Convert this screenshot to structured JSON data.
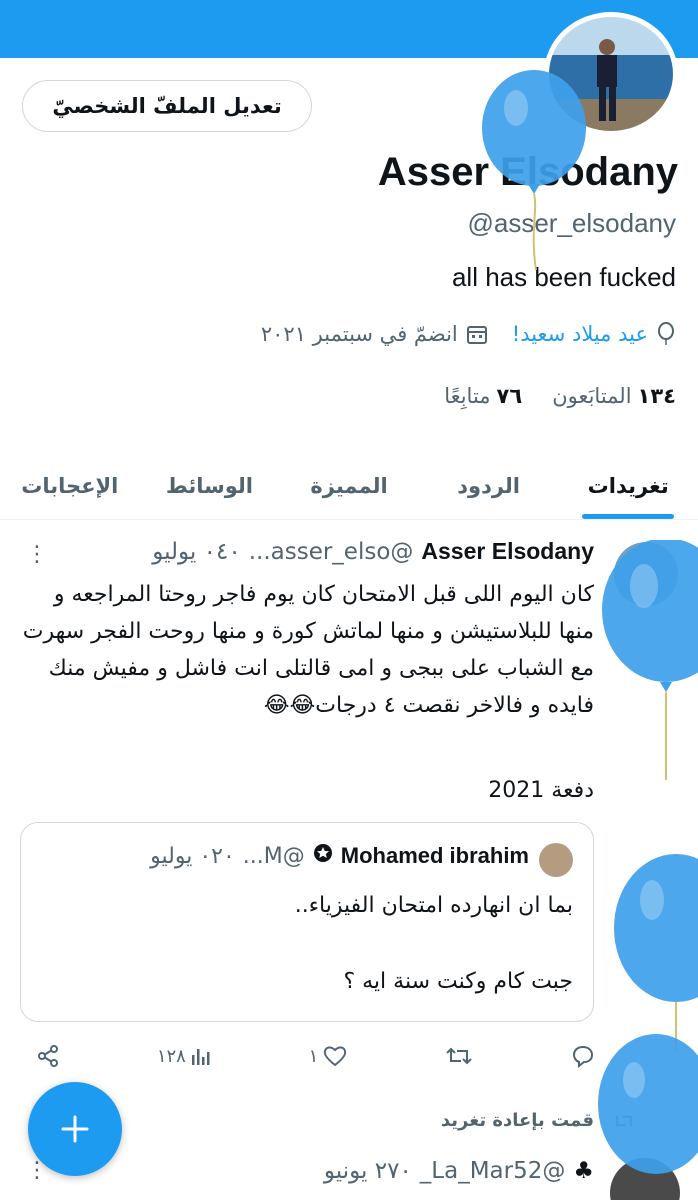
{
  "profile": {
    "edit_button": "تعديل الملفّ الشخصيّ",
    "name": "Asser Elsodany",
    "handle": "@asser_elsodany",
    "bio": "all has been fucked",
    "birthday_link": "عيد ميلاد سعيد!",
    "joined": "انضمّ في سبتمبر ٢٠٢١",
    "followers_count": "١٣٤",
    "followers_label": "المتابَعون",
    "following_count": "٧٦",
    "following_label": "متابِعًا"
  },
  "tabs": [
    "تغريدات",
    "الردود",
    "المميزة",
    "الوسائط",
    "الإعجابات"
  ],
  "tweet": {
    "name": "Asser Elsodany",
    "handle": "@asser_elso...",
    "date": "٠٤٠ يوليو",
    "body": "كان اليوم اللى قبل الامتحان كان يوم فاجر روحتا المراجعه و منها للبلاستيشن و منها لماتش كورة و منها روحت الفجر سهرت مع الشباب على ببجى و امى قالتلى انت فاشل و مفيش منك فايده و فالاخر نقصت ٤ درجات😂😂",
    "footer": "دفعة 2021",
    "quote": {
      "name": "Mohamed ibrahim",
      "handle": "@M...",
      "date": "٠٢٠ يوليو",
      "line1": "بما ان انهارده امتحان الفيزياء..",
      "line2": "جبت كام وكنت سنة ايه ؟"
    },
    "views": "١٢٨",
    "likes": "١"
  },
  "next": {
    "retweeted_label": "قمت بإعادة تغريد",
    "handle": "@La_Mar52_",
    "date": "٢٧٠ يونيو"
  },
  "colors": {
    "accent": "#1d9bf0",
    "text": "#0f1419",
    "muted": "#536471"
  }
}
